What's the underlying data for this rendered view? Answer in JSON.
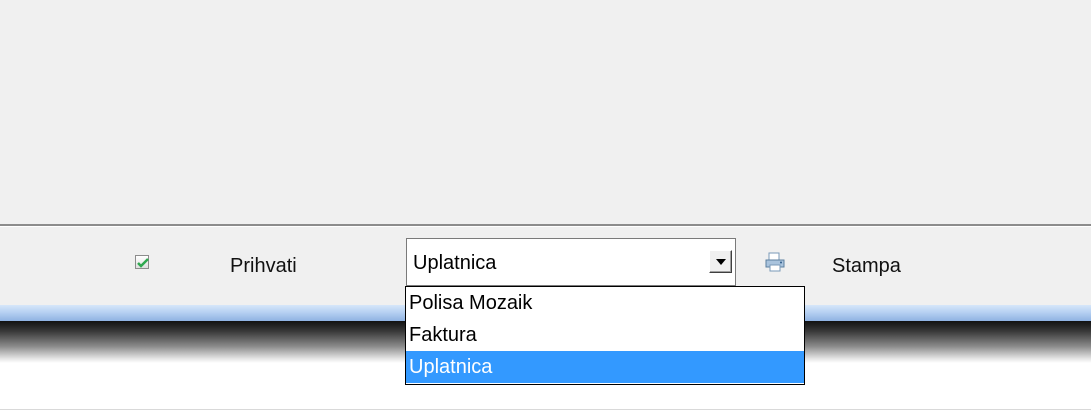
{
  "toolbar": {
    "accept_label": "Prihvati",
    "print_label": "Stampa",
    "accept_icon": "accept-check-icon",
    "print_icon": "printer-icon"
  },
  "document_select": {
    "value": "Uplatnica",
    "options": [
      "Polisa Mozaik",
      "Faktura",
      "Uplatnica"
    ],
    "selected_index": 2
  },
  "colors": {
    "selection": "#3399ff",
    "panel": "#f0f0f0",
    "check": "#2fa84f"
  }
}
